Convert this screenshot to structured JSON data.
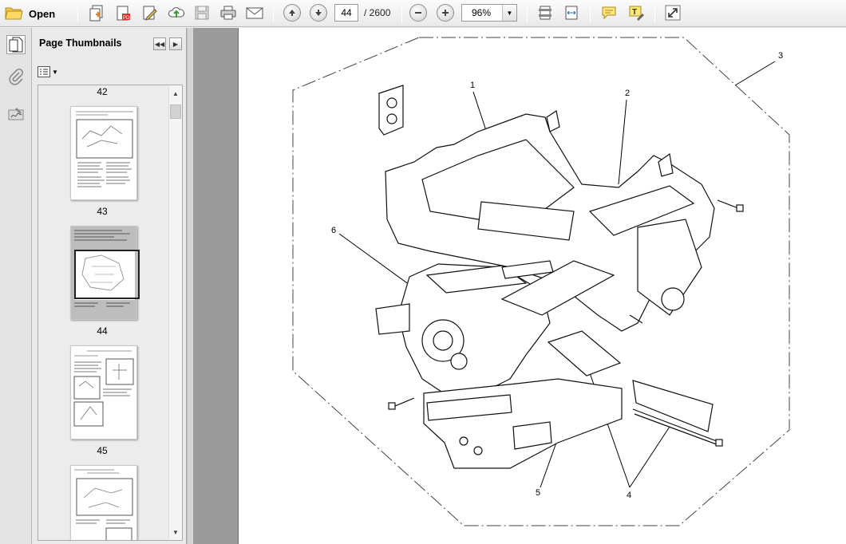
{
  "toolbar": {
    "open_label": "Open",
    "current_page": "44",
    "page_total": "/ 2600",
    "zoom": "96%",
    "icons": [
      "folder-open-icon",
      "create-pdf-icon",
      "export-pdf-icon",
      "edit-icon",
      "upload-cloud-icon",
      "save-icon",
      "print-icon",
      "email-icon",
      "prev-page-icon",
      "next-page-icon",
      "zoom-out-icon",
      "zoom-in-icon",
      "fit-page-icon",
      "fit-width-icon",
      "comment-icon",
      "highlight-icon",
      "fullscreen-icon"
    ]
  },
  "sidebar": {
    "rail_icons": [
      "page-thumbnails-icon",
      "attachments-icon",
      "signatures-icon"
    ]
  },
  "panel": {
    "title": "Page Thumbnails",
    "thumbnails": [
      {
        "page": "42"
      },
      {
        "page": "43"
      },
      {
        "page": "44",
        "selected": true
      },
      {
        "page": "45"
      }
    ]
  },
  "document": {
    "callouts": [
      "1",
      "2",
      "3",
      "4",
      "4",
      "5",
      "6"
    ]
  }
}
